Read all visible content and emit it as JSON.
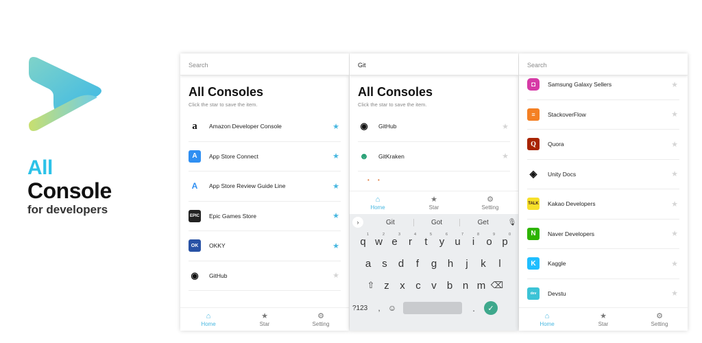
{
  "brand": {
    "line1": "All",
    "line2": "Console",
    "line3": "for developers"
  },
  "colors": {
    "accent": "#47b7e0",
    "star_off": "#d5d5d5"
  },
  "phone1": {
    "search_placeholder": "Search",
    "title": "All Consoles",
    "subtitle": "Click the star to save the item.",
    "items": [
      {
        "name": "Amazon Developer Console",
        "icon": "amazon-icon",
        "starred": true
      },
      {
        "name": "App Store Connect",
        "icon": "app-store-icon",
        "starred": true
      },
      {
        "name": "App Store Review Guide Line",
        "icon": "app-store-review-icon",
        "starred": true
      },
      {
        "name": "Epic Games Store",
        "icon": "epic-games-icon",
        "starred": true
      },
      {
        "name": "OKKY",
        "icon": "okky-icon",
        "starred": true
      },
      {
        "name": "GitHub",
        "icon": "github-icon",
        "starred": false
      }
    ]
  },
  "phone2": {
    "search_value": "Git",
    "title": "All Consoles",
    "subtitle": "Click the star to save the item.",
    "items": [
      {
        "name": "GitHub",
        "icon": "github-icon",
        "starred": false
      },
      {
        "name": "GitKraken",
        "icon": "gitkraken-icon",
        "starred": false
      }
    ],
    "suggestions": [
      "Git",
      "Got",
      "Get"
    ],
    "keys_row1": [
      "q",
      "w",
      "e",
      "r",
      "t",
      "y",
      "u",
      "i",
      "o",
      "p"
    ],
    "keys_row1_num": [
      "1",
      "2",
      "3",
      "4",
      "5",
      "6",
      "7",
      "8",
      "9",
      "0"
    ],
    "keys_row2": [
      "a",
      "s",
      "d",
      "f",
      "g",
      "h",
      "j",
      "k",
      "l"
    ],
    "keys_row3": [
      "z",
      "x",
      "c",
      "v",
      "b",
      "n",
      "m"
    ],
    "key_123": "?123",
    "key_comma": ",",
    "key_dot": "."
  },
  "phone3": {
    "search_placeholder": "Search",
    "items": [
      {
        "name": "Samsung Galaxy Sellers",
        "icon": "samsung-galaxy-store-icon",
        "starred": false
      },
      {
        "name": "StackoverFlow",
        "icon": "stackoverflow-icon",
        "starred": false
      },
      {
        "name": "Quora",
        "icon": "quora-icon",
        "starred": false
      },
      {
        "name": "Unity Docs",
        "icon": "unity-icon",
        "starred": false
      },
      {
        "name": "Kakao Developers",
        "icon": "kakao-icon",
        "starred": false
      },
      {
        "name": "Naver Developers",
        "icon": "naver-icon",
        "starred": false
      },
      {
        "name": "Kaggle",
        "icon": "kaggle-icon",
        "starred": false
      },
      {
        "name": "Devstu",
        "icon": "devstu-icon",
        "starred": false
      }
    ]
  },
  "tabs": [
    {
      "label": "Home",
      "icon": "home-icon"
    },
    {
      "label": "Star",
      "icon": "star-icon"
    },
    {
      "label": "Setting",
      "icon": "gear-icon"
    }
  ]
}
